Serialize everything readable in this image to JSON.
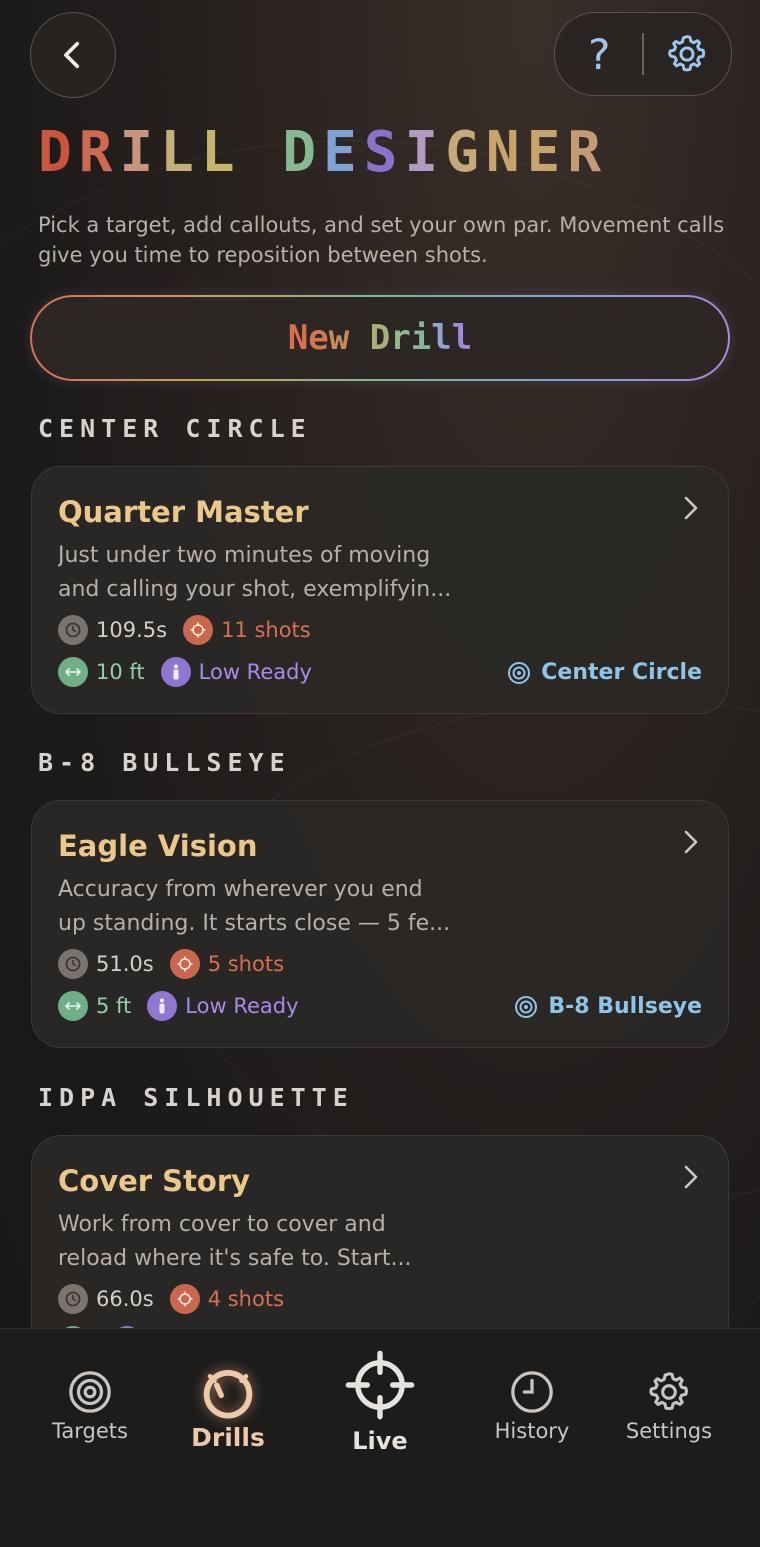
{
  "header": {
    "back_icon": "chevron-left-icon",
    "help_label": "?",
    "settings_icon": "gear-icon",
    "title_letters": [
      {
        "ch": "D",
        "color": "#c9553c"
      },
      {
        "ch": "R",
        "color": "#d06a4e"
      },
      {
        "ch": "I",
        "color": "#c8957c"
      },
      {
        "ch": "L",
        "color": "#c4b077"
      },
      {
        "ch": "L",
        "color": "#c7b66a"
      },
      {
        "ch": " ",
        "color": "#000000"
      },
      {
        "ch": "D",
        "color": "#86b98f"
      },
      {
        "ch": "E",
        "color": "#7fa3d6"
      },
      {
        "ch": "S",
        "color": "#8a72cc"
      },
      {
        "ch": "I",
        "color": "#b39ac2"
      },
      {
        "ch": "G",
        "color": "#c8a878"
      },
      {
        "ch": "N",
        "color": "#c8a46c"
      },
      {
        "ch": "E",
        "color": "#c8a46c"
      },
      {
        "ch": "R",
        "color": "#c39c76"
      }
    ],
    "subtitle": "Pick a target, add callouts, and set your own par. Movement calls give you time to reposition between shots."
  },
  "new_drill": {
    "letters": [
      {
        "ch": "N",
        "color": "#d86e4c"
      },
      {
        "ch": "e",
        "color": "#d2774e"
      },
      {
        "ch": "w",
        "color": "#c88a5c"
      },
      {
        "ch": " ",
        "color": "#000000"
      },
      {
        "ch": "D",
        "color": "#a8b07a"
      },
      {
        "ch": "r",
        "color": "#8fbc88"
      },
      {
        "ch": "i",
        "color": "#86b6a0"
      },
      {
        "ch": "l",
        "color": "#8fa6d2"
      },
      {
        "ch": "l",
        "color": "#a08ae0"
      }
    ]
  },
  "sections": [
    {
      "label": "CENTER CIRCLE",
      "drill": {
        "title": "Quarter Master",
        "desc_lines": [
          "Just under two minutes of moving",
          "and calling your shot, exemplifyin..."
        ],
        "time": "109.5s",
        "shots": "11 shots",
        "distance": "10 ft",
        "position": "Low Ready",
        "target": "Center Circle"
      }
    },
    {
      "label": "B-8 BULLSEYE",
      "drill": {
        "title": "Eagle Vision",
        "desc_lines": [
          "Accuracy from wherever you end",
          "up standing. It starts close — 5 fe..."
        ],
        "time": "51.0s",
        "shots": "5 shots",
        "distance": "5 ft",
        "position": "Low Ready",
        "target": "B-8 Bullseye"
      }
    },
    {
      "label": "IDPA SILHOUETTE",
      "drill": {
        "title": "Cover Story",
        "desc_lines": [
          "Work from cover to cover and",
          "reload where it's safe to. Start..."
        ],
        "time": "66.0s",
        "shots": "4 shots"
      }
    }
  ],
  "tabs": [
    {
      "label": "Targets",
      "icon": "target-icon"
    },
    {
      "label": "Drills",
      "icon": "stopwatch-icon",
      "active": true
    },
    {
      "label": "Live",
      "icon": "crosshair-icon"
    },
    {
      "label": "History",
      "icon": "clock-icon"
    },
    {
      "label": "Settings",
      "icon": "gear-icon"
    }
  ]
}
